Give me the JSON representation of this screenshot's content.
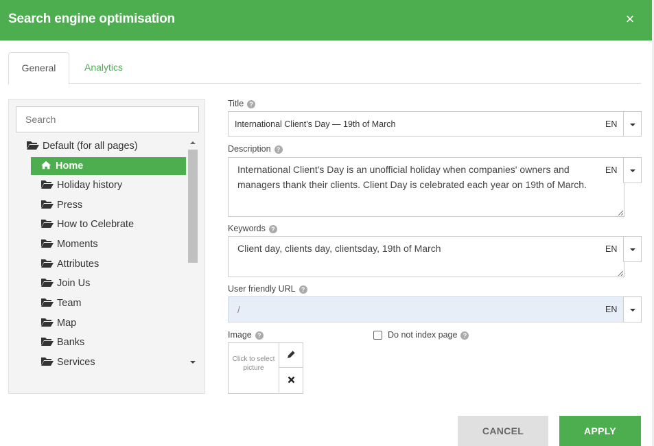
{
  "dialog": {
    "title": "Search engine optimisation",
    "close_symbol": "×"
  },
  "tabs": [
    {
      "label": "General",
      "active": true
    },
    {
      "label": "Analytics",
      "active": false
    }
  ],
  "tree": {
    "search_placeholder": "Search",
    "root_label": "Default (for all pages)",
    "items": [
      {
        "label": "Home",
        "icon": "home-icon",
        "active": true
      },
      {
        "label": "Holiday history",
        "icon": "folder-open-icon"
      },
      {
        "label": "Press",
        "icon": "folder-open-icon"
      },
      {
        "label": "How to Celebrate",
        "icon": "folder-open-icon"
      },
      {
        "label": "Moments",
        "icon": "folder-open-icon"
      },
      {
        "label": "Attributes",
        "icon": "folder-open-icon"
      },
      {
        "label": "Join Us",
        "icon": "folder-open-icon"
      },
      {
        "label": "Team",
        "icon": "folder-open-icon"
      },
      {
        "label": "Map",
        "icon": "folder-open-icon"
      },
      {
        "label": "Banks",
        "icon": "folder-open-icon"
      },
      {
        "label": "Services",
        "icon": "folder-open-icon"
      }
    ]
  },
  "form": {
    "title": {
      "label": "Title",
      "value": "International Client's Day — 19th of March",
      "lang": "EN"
    },
    "description": {
      "label": "Description",
      "value": "International Client's Day is an unofficial holiday when companies' owners and managers thank their clients. Client Day is celebrated each year on 19th of March.",
      "lang": "EN"
    },
    "keywords": {
      "label": "Keywords",
      "value": "Client day, clients day, clientsday, 19th of March",
      "lang": "EN"
    },
    "url": {
      "label": "User friendly URL",
      "value": "/",
      "lang": "EN"
    },
    "image": {
      "label": "Image",
      "placeholder": "Click to select picture"
    },
    "noindex": {
      "label": "Do not index page",
      "checked": false
    }
  },
  "buttons": {
    "cancel": "CANCEL",
    "apply": "APPLY"
  },
  "colors": {
    "accent": "#4cae4f",
    "url_bg": "#e8eef8"
  }
}
